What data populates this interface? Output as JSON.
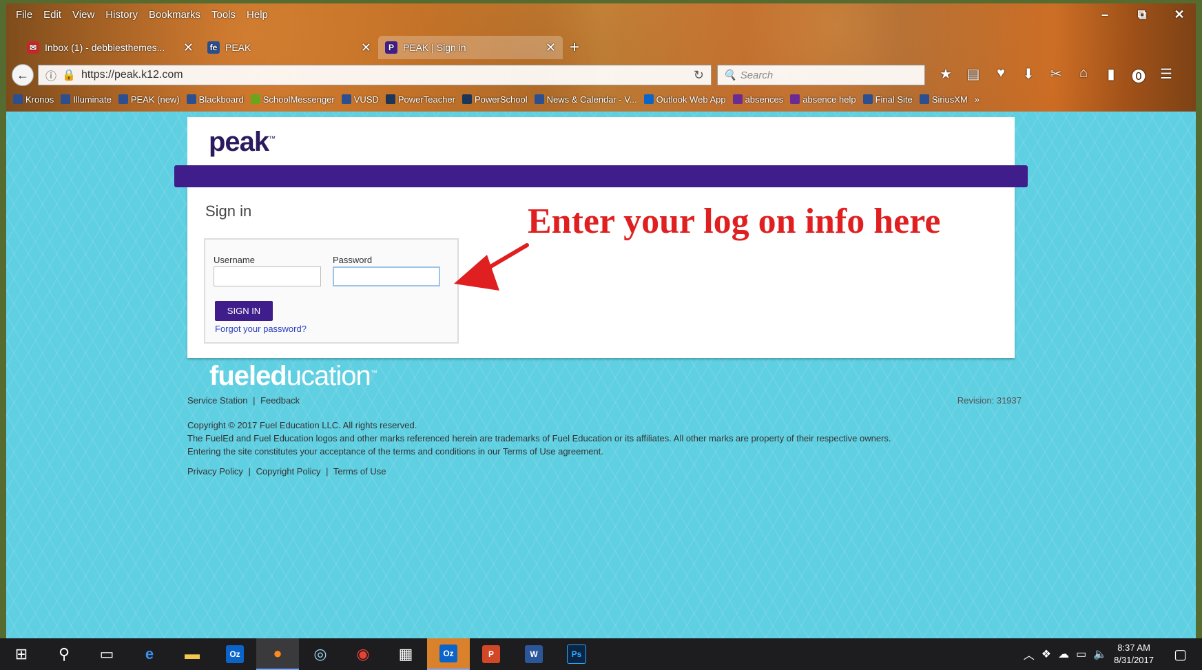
{
  "browser": {
    "menu": [
      "File",
      "Edit",
      "View",
      "History",
      "Bookmarks",
      "Tools",
      "Help"
    ],
    "window_controls": {
      "minimize": "–",
      "maximize": "⧉",
      "close": "✕"
    },
    "tabs": [
      {
        "label": "Inbox (1) - debbiesthemes...",
        "icon": "mail-icon",
        "close": "✕"
      },
      {
        "label": "PEAK",
        "icon": "fe-icon",
        "close": "✕"
      },
      {
        "label": "PEAK | Sign in",
        "icon": "p-icon",
        "close": "✕"
      }
    ],
    "new_tab": "+",
    "url": "https://peak.k12.com",
    "search_placeholder": "Search",
    "bookmarks": [
      "Kronos",
      "Illuminate",
      "PEAK (new)",
      "Blackboard",
      "SchoolMessenger",
      "VUSD",
      "PowerTeacher",
      "PowerSchool",
      "News & Calendar - V...",
      "Outlook Web App",
      "absences",
      "absence help",
      "Final Site",
      "SiriusXM"
    ],
    "bookmarks_more": "»"
  },
  "page": {
    "logo": "peak",
    "logo_tm": "™",
    "signin_title": "Sign in",
    "username_label": "Username",
    "password_label": "Password",
    "signin_button": "SIGN IN",
    "forgot_link": "Forgot your password?",
    "annotation": "Enter your log on info here",
    "fuel_logo_bold": "fueled",
    "fuel_logo_light": "ucation",
    "fuel_logo_tm": "™",
    "footer_links": {
      "service": "Service Station",
      "feedback": "Feedback",
      "sep": "|"
    },
    "revision": "Revision: 31937",
    "copyright_1": "Copyright © 2017 Fuel Education LLC. All rights reserved.",
    "copyright_2": "The FuelEd and Fuel Education logos and other marks referenced herein are trademarks of Fuel Education or its affiliates. All other marks are property of their respective owners.",
    "copyright_3": "Entering the site constitutes your acceptance of the terms and conditions in our Terms of Use agreement.",
    "policies": {
      "privacy": "Privacy Policy",
      "copyright": "Copyright Policy",
      "terms": "Terms of Use",
      "sep": "|"
    }
  },
  "taskbar": {
    "time": "8:37 AM",
    "date": "8/31/2017",
    "apps": [
      "start-icon",
      "search-icon",
      "task-view-icon",
      "edge-icon",
      "file-explorer-icon",
      "outlook-icon",
      "firefox-icon",
      "network-icon",
      "chrome-icon",
      "calculator-icon",
      "outlook-active-icon",
      "powerpoint-icon",
      "word-icon",
      "photoshop-icon"
    ],
    "app_letters": {
      "outlook": "Oz",
      "powerpoint": "P",
      "word": "W",
      "photoshop": "Ps"
    }
  },
  "colors": {
    "brand_purple": "#3f1d8a",
    "page_bg": "#5fcfe2",
    "annotation_red": "#e02020"
  }
}
